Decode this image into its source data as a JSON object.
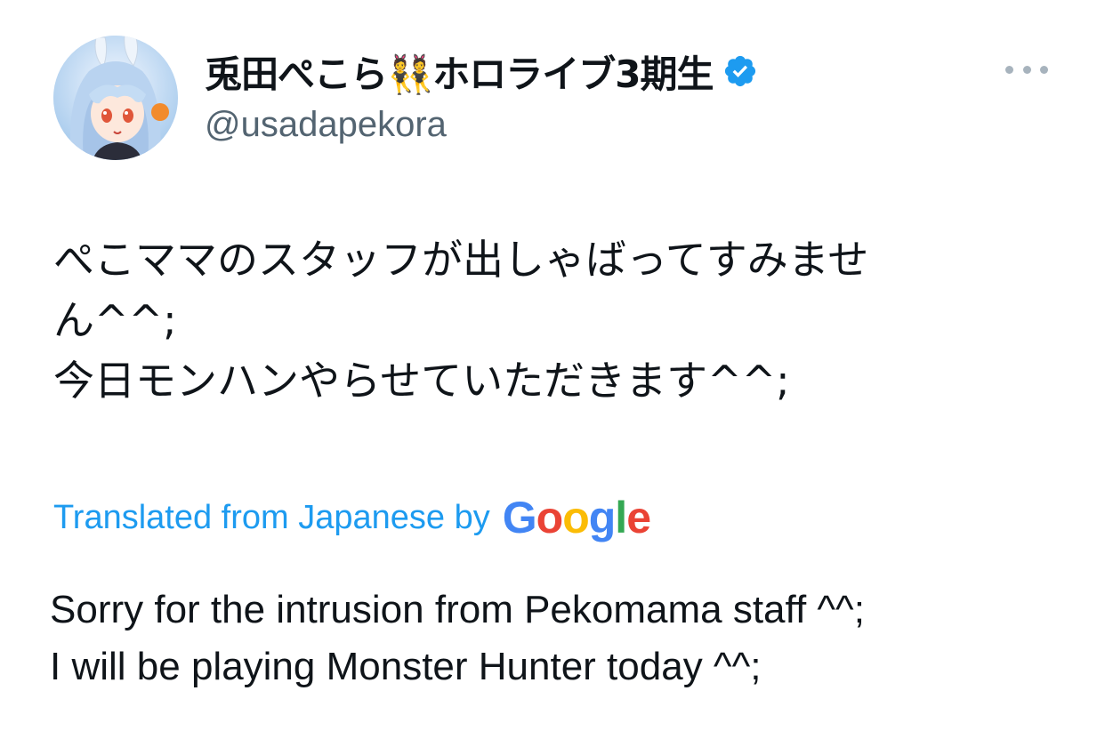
{
  "author": {
    "display_name": "兎田ぺこら👯ホロライブ3期生",
    "handle": "@usadapekora",
    "avatar_icon": "avatar-bunny-girl",
    "verified_icon": "verified-badge-icon",
    "verified_color": "#1d9bf0"
  },
  "menu": {
    "icon": "more-options-icon"
  },
  "tweet": {
    "lines": [
      "ぺこママのスタッフが出しゃばってすみませ",
      "ん^^;",
      "今日モンハンやらせていただきます^^;"
    ]
  },
  "translation": {
    "label": "Translated from Japanese by",
    "provider": "Google",
    "lines": [
      "Sorry for the intrusion from Pekomama staff ^^;",
      "I will be playing Monster Hunter today ^^;"
    ]
  },
  "colors": {
    "link": "#1d9bf0",
    "secondary_text": "#536471",
    "primary_text": "#0f1419"
  }
}
